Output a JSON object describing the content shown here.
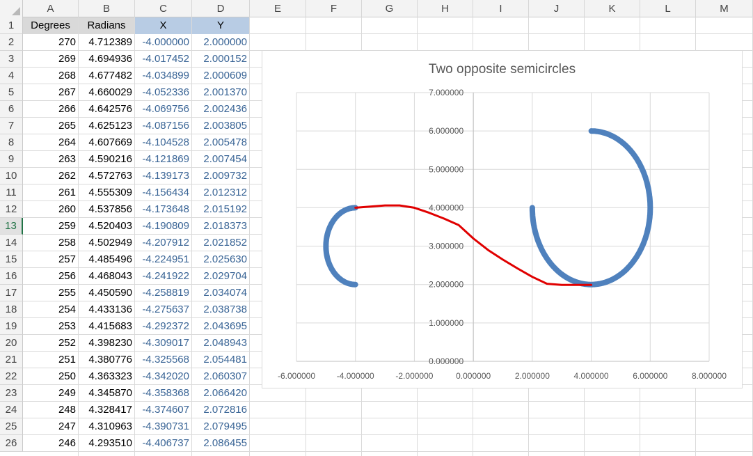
{
  "spreadsheet": {
    "columns": [
      "A",
      "B",
      "C",
      "D",
      "E",
      "F",
      "G",
      "H",
      "I",
      "J",
      "K",
      "L",
      "M"
    ],
    "active_row": 13,
    "headers": {
      "a": "Degrees",
      "b": "Radians",
      "c": "X",
      "d": "Y"
    },
    "rows": [
      {
        "n": "1"
      },
      {
        "n": "2",
        "a": "270",
        "b": "4.712389",
        "c": "-4.000000",
        "d": "2.000000"
      },
      {
        "n": "3",
        "a": "269",
        "b": "4.694936",
        "c": "-4.017452",
        "d": "2.000152"
      },
      {
        "n": "4",
        "a": "268",
        "b": "4.677482",
        "c": "-4.034899",
        "d": "2.000609"
      },
      {
        "n": "5",
        "a": "267",
        "b": "4.660029",
        "c": "-4.052336",
        "d": "2.001370"
      },
      {
        "n": "6",
        "a": "266",
        "b": "4.642576",
        "c": "-4.069756",
        "d": "2.002436"
      },
      {
        "n": "7",
        "a": "265",
        "b": "4.625123",
        "c": "-4.087156",
        "d": "2.003805"
      },
      {
        "n": "8",
        "a": "264",
        "b": "4.607669",
        "c": "-4.104528",
        "d": "2.005478"
      },
      {
        "n": "9",
        "a": "263",
        "b": "4.590216",
        "c": "-4.121869",
        "d": "2.007454"
      },
      {
        "n": "10",
        "a": "262",
        "b": "4.572763",
        "c": "-4.139173",
        "d": "2.009732"
      },
      {
        "n": "11",
        "a": "261",
        "b": "4.555309",
        "c": "-4.156434",
        "d": "2.012312"
      },
      {
        "n": "12",
        "a": "260",
        "b": "4.537856",
        "c": "-4.173648",
        "d": "2.015192"
      },
      {
        "n": "13",
        "a": "259",
        "b": "4.520403",
        "c": "-4.190809",
        "d": "2.018373"
      },
      {
        "n": "14",
        "a": "258",
        "b": "4.502949",
        "c": "-4.207912",
        "d": "2.021852"
      },
      {
        "n": "15",
        "a": "257",
        "b": "4.485496",
        "c": "-4.224951",
        "d": "2.025630"
      },
      {
        "n": "16",
        "a": "256",
        "b": "4.468043",
        "c": "-4.241922",
        "d": "2.029704"
      },
      {
        "n": "17",
        "a": "255",
        "b": "4.450590",
        "c": "-4.258819",
        "d": "2.034074"
      },
      {
        "n": "18",
        "a": "254",
        "b": "4.433136",
        "c": "-4.275637",
        "d": "2.038738"
      },
      {
        "n": "19",
        "a": "253",
        "b": "4.415683",
        "c": "-4.292372",
        "d": "2.043695"
      },
      {
        "n": "20",
        "a": "252",
        "b": "4.398230",
        "c": "-4.309017",
        "d": "2.048943"
      },
      {
        "n": "21",
        "a": "251",
        "b": "4.380776",
        "c": "-4.325568",
        "d": "2.054481"
      },
      {
        "n": "22",
        "a": "250",
        "b": "4.363323",
        "c": "-4.342020",
        "d": "2.060307"
      },
      {
        "n": "23",
        "a": "249",
        "b": "4.345870",
        "c": "-4.358368",
        "d": "2.066420"
      },
      {
        "n": "24",
        "a": "248",
        "b": "4.328417",
        "c": "-4.374607",
        "d": "2.072816"
      },
      {
        "n": "25",
        "a": "247",
        "b": "4.310963",
        "c": "-4.390731",
        "d": "2.079495"
      },
      {
        "n": "26",
        "a": "246",
        "b": "4.293510",
        "c": "-4.406737",
        "d": "2.086455"
      }
    ]
  },
  "chart_data": {
    "type": "scatter",
    "title": "Two opposite semicircles",
    "xlabel": "",
    "ylabel": "",
    "xlim": [
      -6,
      8
    ],
    "ylim": [
      0,
      7
    ],
    "x_ticks": [
      "-6.000000",
      "-4.000000",
      "-2.000000",
      "0.000000",
      "2.000000",
      "4.000000",
      "6.000000",
      "8.000000"
    ],
    "y_ticks": [
      "0.000000",
      "1.000000",
      "2.000000",
      "3.000000",
      "4.000000",
      "5.000000",
      "6.000000",
      "7.000000"
    ],
    "grid": true,
    "legend": "none",
    "series": [
      {
        "color": "#4f81bd",
        "shape": "semicircle",
        "center": [
          -4,
          3
        ],
        "radius": 1,
        "start_deg": 90,
        "end_deg": 270
      },
      {
        "color": "#4f81bd",
        "shape": "arc",
        "center": [
          4,
          4
        ],
        "radius": 2,
        "start_deg": 180,
        "end_deg": 450
      },
      {
        "color": "#e00000",
        "shape": "line",
        "x": [
          -4.0,
          -3.5,
          -3.0,
          -2.5,
          -2.0,
          -1.5,
          -1.0,
          -0.5,
          0.0,
          0.5,
          1.0,
          1.5,
          2.0,
          2.5,
          3.0,
          3.5,
          4.0
        ],
        "y": [
          4.0,
          4.03,
          4.06,
          4.06,
          4.0,
          3.87,
          3.72,
          3.55,
          3.2,
          2.9,
          2.65,
          2.42,
          2.2,
          2.02,
          1.99,
          1.99,
          1.99
        ]
      }
    ]
  }
}
